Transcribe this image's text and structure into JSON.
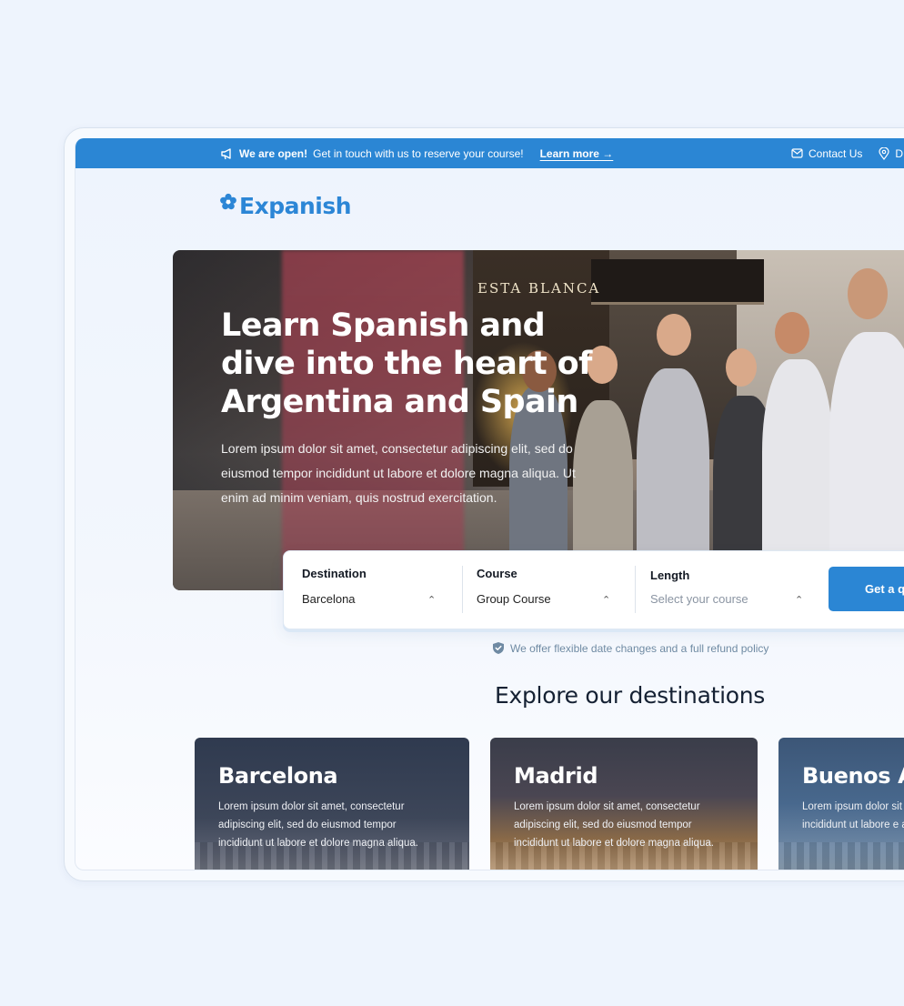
{
  "announcement": {
    "bold": "We are open!",
    "text": "Get in touch with us to reserve your course!",
    "link": "Learn more",
    "contact": "Contact Us",
    "location_partial": "D"
  },
  "brand": {
    "name": "Expanish",
    "color": "#2c86d6"
  },
  "hero": {
    "title": "Learn Spanish and dive into the heart of Argentina and Spain",
    "body": "Lorem ipsum dolor sit amet, consectetur adipiscing elit, sed do eiusmod tempor incididunt ut labore et dolore magna aliqua. Ut enim ad minim veniam, quis nostrud exercitation.",
    "sign": "ESTA BLANCA"
  },
  "booking": {
    "destination_label": "Destination",
    "destination_value": "Barcelona",
    "course_label": "Course",
    "course_value": "Group Course",
    "length_label": "Length",
    "length_placeholder": "Select your course",
    "cta": "Get a q"
  },
  "refund_note": "We offer flexible date changes and a full refund policy",
  "destinations": {
    "title": "Explore our destinations",
    "cards": [
      {
        "name": "Barcelona",
        "desc": "Lorem ipsum dolor sit amet, consectetur adipiscing elit, sed do eiusmod tempor incididunt ut labore et dolore magna aliqua."
      },
      {
        "name": "Madrid",
        "desc": "Lorem ipsum dolor sit amet, consectetur adipiscing elit, sed do eiusmod tempor incididunt ut labore et dolore magna aliqua."
      },
      {
        "name": "Buenos Ai",
        "desc": "Lorem ipsum dolor sit amet, sed do eiusmod incididunt ut labore e aliqua."
      }
    ]
  },
  "colors": {
    "primary": "#2b86d4",
    "text_dark": "#141a24"
  }
}
